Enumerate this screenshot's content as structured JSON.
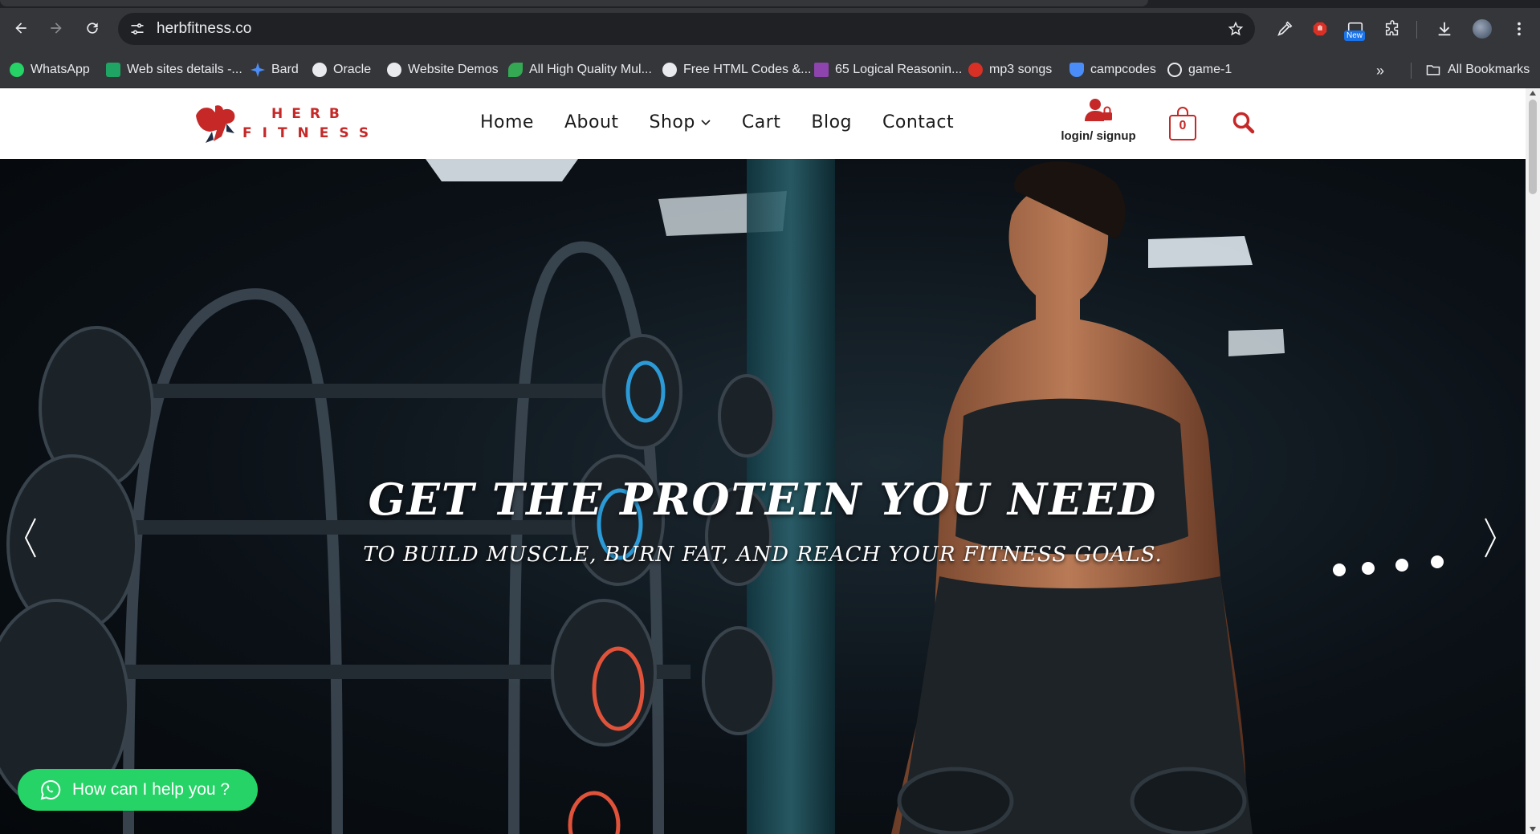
{
  "browser": {
    "url": "herbfitness.co",
    "bookmarks": [
      {
        "label": "WhatsApp",
        "icon": "whatsapp-icon",
        "color": "#25d366"
      },
      {
        "label": "Web sites details -...",
        "icon": "sheets-icon",
        "color": "#1fa463"
      },
      {
        "label": "Bard",
        "icon": "bard-icon",
        "color": "#4b8df8"
      },
      {
        "label": "Oracle",
        "icon": "globe-icon",
        "color": "#e8eaed"
      },
      {
        "label": "Website Demos",
        "icon": "globe-icon",
        "color": "#e8eaed"
      },
      {
        "label": "All High Quality Mul...",
        "icon": "leaf-icon",
        "color": "#34a853"
      },
      {
        "label": "Free HTML Codes &...",
        "icon": "globe-icon",
        "color": "#e8eaed"
      },
      {
        "label": "65 Logical Reasonin...",
        "icon": "m-icon",
        "color": "#8e44ad"
      },
      {
        "label": "mp3 songs",
        "icon": "music-icon",
        "color": "#d93025"
      },
      {
        "label": "campcodes",
        "icon": "shield-icon",
        "color": "#4b8df8"
      },
      {
        "label": "game-1",
        "icon": "edge-icon",
        "color": "#e8eaed"
      }
    ],
    "all_bookmarks": "All Bookmarks",
    "new_badge": "New"
  },
  "site": {
    "nav": [
      "Home",
      "About",
      "Shop",
      "Cart",
      "Blog",
      "Contact"
    ],
    "account_label": "login/ signup",
    "cart_count": "0",
    "brand_color": "#c62828"
  },
  "hero": {
    "title": "GET THE PROTEIN YOU NEED",
    "subtitle": "TO BUILD MUSCLE, BURN FAT, AND REACH YOUR FITNESS GOALS."
  },
  "chat": {
    "label": "How can I help you ?",
    "color": "#25d366"
  }
}
